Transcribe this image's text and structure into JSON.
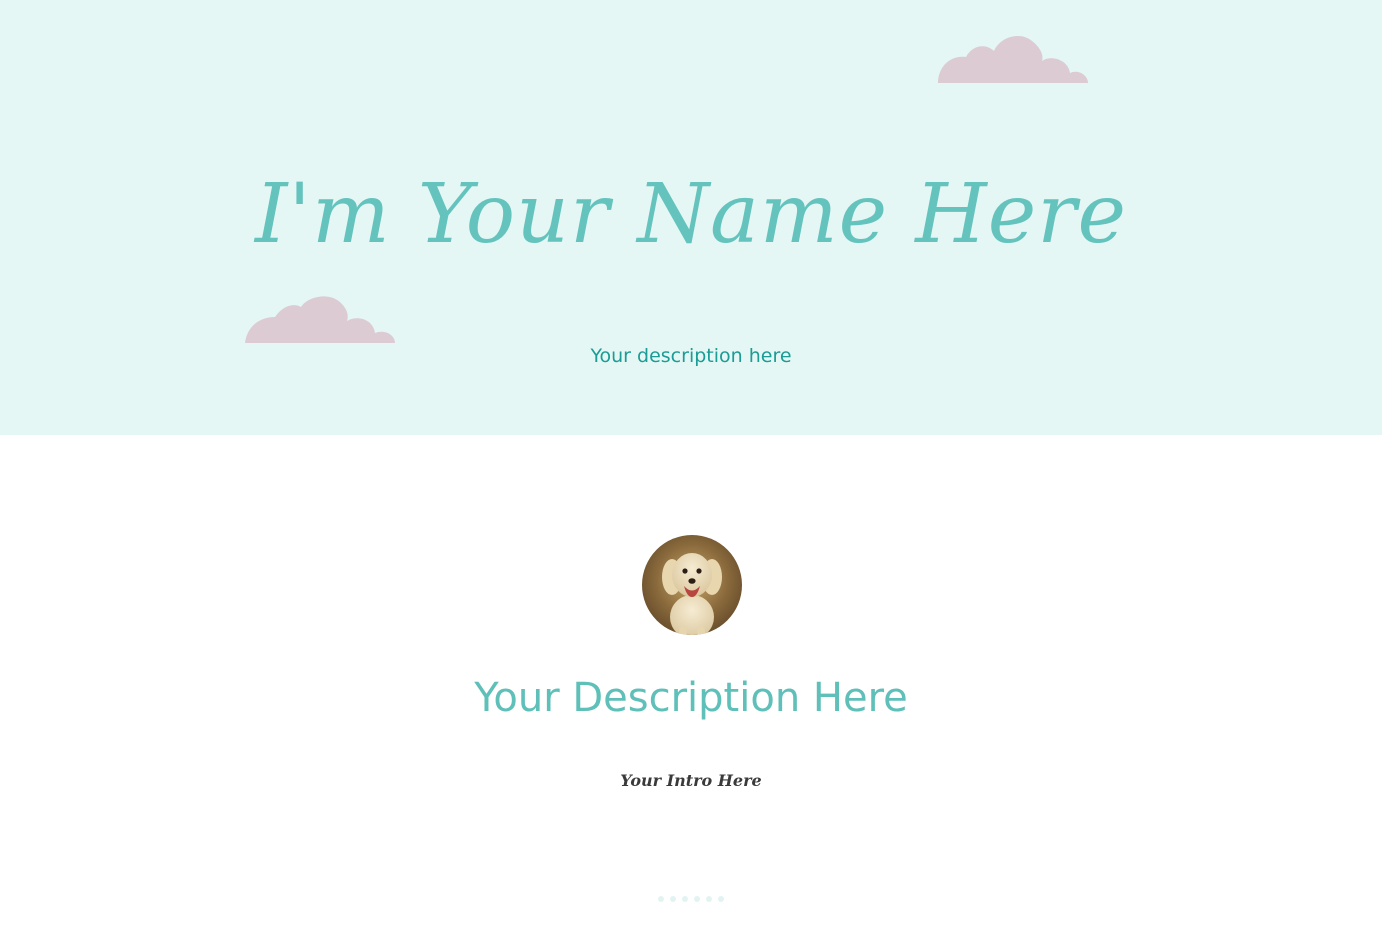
{
  "hero": {
    "title": "I'm Your Name Here",
    "subtitle": "Your description here"
  },
  "about": {
    "avatar": "puppy-photo",
    "heading": "Your Description Here",
    "intro": "Your Intro Here"
  },
  "pagination": {
    "dot_count": 6
  },
  "colors": {
    "hero_background": "#e4f7f5",
    "title_teal": "#65c3be",
    "subtitle_teal": "#1b9c94",
    "cloud_pink": "#dccbd2",
    "intro_text": "#3a3a3a",
    "dot": "#e2f4f2"
  },
  "icons": {
    "cloud": "cloud-icon"
  }
}
